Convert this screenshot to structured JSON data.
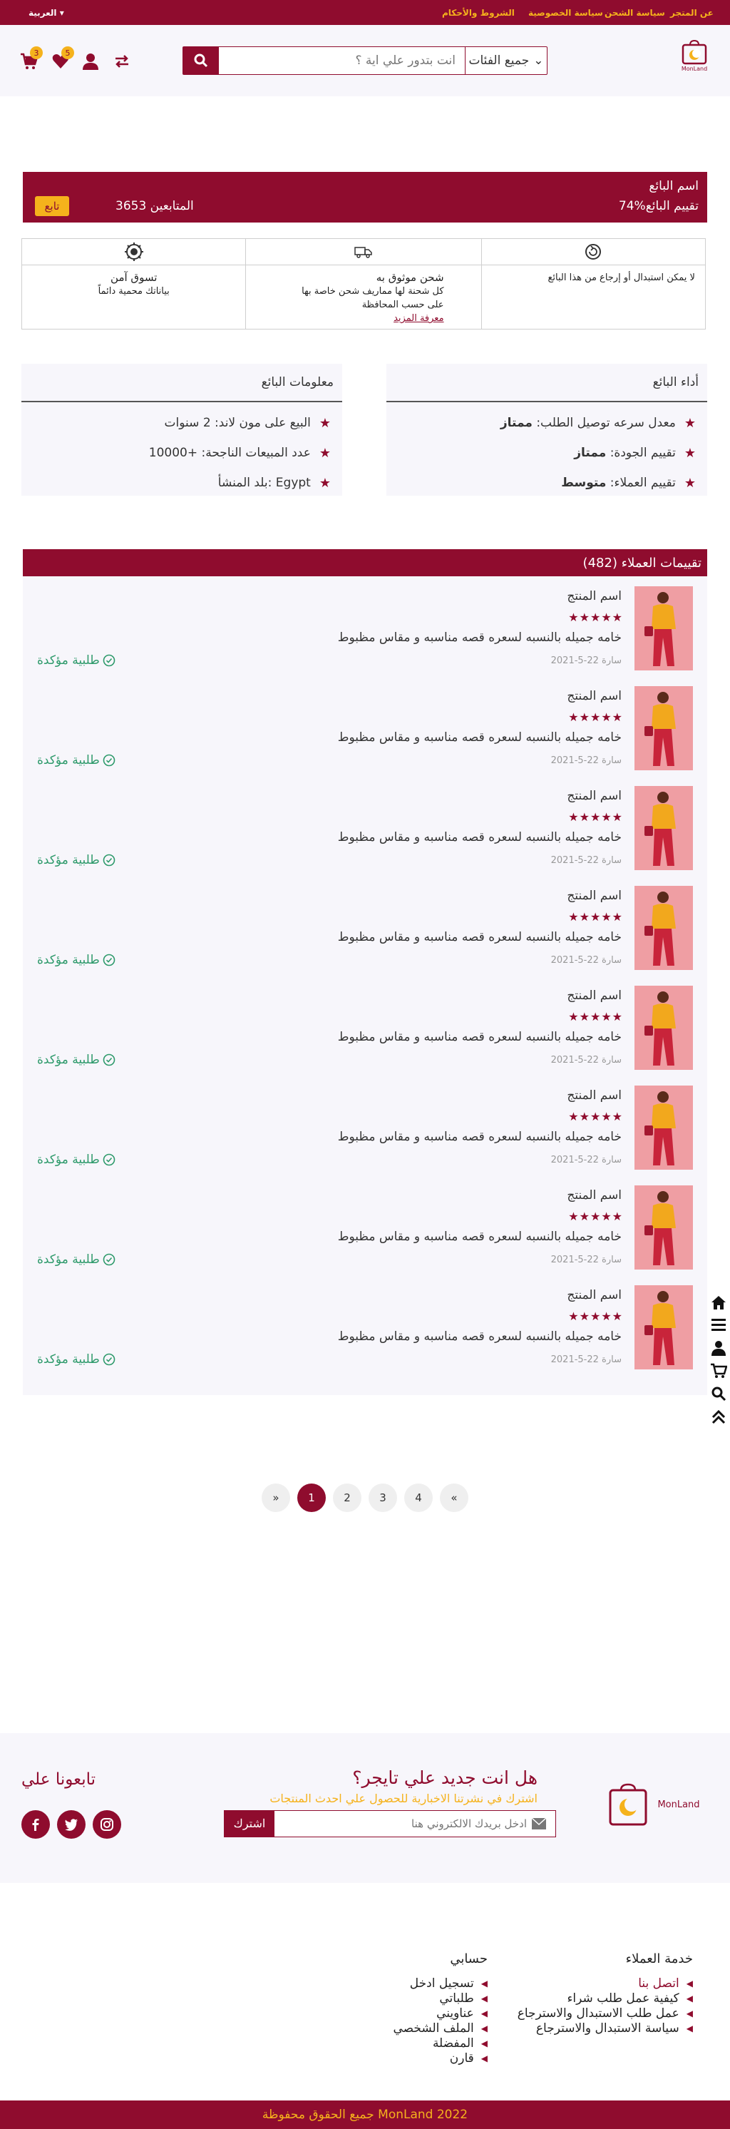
{
  "topbar": {
    "language": "العربية",
    "links": [
      "عن المتجر",
      "سياسة الشحن",
      "سياسة الخصوصية",
      "الشروط والأحكام"
    ]
  },
  "header": {
    "search_placeholder": "انت بتدور علي اية ؟",
    "category_label": "جميع الفئات",
    "cart_count": "3",
    "wishlist_count": "5",
    "logo_text": "MonLand"
  },
  "seller": {
    "name": "اسم البائع",
    "rating": "74%تقييم البائع",
    "followers": "3653 المتابعين",
    "follow_label": "تابع"
  },
  "features": [
    {
      "title": "",
      "text": "لا يمكن استبدال أو إرجاع من هذا البائع"
    },
    {
      "title": "شحن موثوق به",
      "text": "كل شحنة لها مماريف شحن خاصة بها على حسب المحافظة",
      "more": "معرفة المزيد"
    },
    {
      "title": "تسوق آمن",
      "text": "بياناتك محمية دائماً"
    }
  ],
  "performance": {
    "title": "أداء البائع",
    "rows": [
      {
        "label": "معدل سرعه توصيل الطلب:",
        "value": "ممتاز"
      },
      {
        "label": "تقييم الجودة:",
        "value": "ممتاز"
      },
      {
        "label": "تقييم العملاء:",
        "value": "متوسط"
      }
    ]
  },
  "info": {
    "title": "معلومات البائع",
    "rows": [
      {
        "label": "البيع على مون لاند: 2 سنوات"
      },
      {
        "label": "عدد المبيعات الناجحة: +10000"
      },
      {
        "label": "بلد المنشأ: Egypt"
      }
    ]
  },
  "reviews": {
    "title": "تقييمات العملاء (482)",
    "items": [
      {
        "product": "اسم المنتج",
        "stars": "★★★★★",
        "text": "خامه جميله بالنسبه لسعره قصه مناسبه و مقاس مظبوط",
        "date": "2021-5-22 سارة",
        "verified": "طلبية مؤكدة"
      },
      {
        "product": "اسم المنتج",
        "stars": "★★★★★",
        "text": "خامه جميله بالنسبه لسعره قصه مناسبه و مقاس مظبوط",
        "date": "2021-5-22 سارة",
        "verified": "طلبية مؤكدة"
      },
      {
        "product": "اسم المنتج",
        "stars": "★★★★★",
        "text": "خامه جميله بالنسبه لسعره قصه مناسبه و مقاس مظبوط",
        "date": "2021-5-22 سارة",
        "verified": "طلبية مؤكدة"
      },
      {
        "product": "اسم المنتج",
        "stars": "★★★★★",
        "text": "خامه جميله بالنسبه لسعره قصه مناسبه و مقاس مظبوط",
        "date": "2021-5-22 سارة",
        "verified": "طلبية مؤكدة"
      },
      {
        "product": "اسم المنتج",
        "stars": "★★★★★",
        "text": "خامه جميله بالنسبه لسعره قصه مناسبه و مقاس مظبوط",
        "date": "2021-5-22 سارة",
        "verified": "طلبية مؤكدة"
      },
      {
        "product": "اسم المنتج",
        "stars": "★★★★★",
        "text": "خامه جميله بالنسبه لسعره قصه مناسبه و مقاس مظبوط",
        "date": "2021-5-22 سارة",
        "verified": "طلبية مؤكدة"
      },
      {
        "product": "اسم المنتج",
        "stars": "★★★★★",
        "text": "خامه جميله بالنسبه لسعره قصه مناسبه و مقاس مظبوط",
        "date": "2021-5-22 سارة",
        "verified": "طلبية مؤكدة"
      },
      {
        "product": "اسم المنتج",
        "stars": "★★★★★",
        "text": "خامه جميله بالنسبه لسعره قصه مناسبه و مقاس مظبوط",
        "date": "2021-5-22 سارة",
        "verified": "طلبية مؤكدة"
      }
    ]
  },
  "pagination": {
    "pages": [
      "»",
      "1",
      "2",
      "3",
      "4",
      "«"
    ],
    "active": "1"
  },
  "newsletter": {
    "title": "هل انت جديد علي تايجر؟",
    "subtitle": "اشترك في نشرتنا الاخبارية للحصول علي احدث المنتجات",
    "placeholder": "ادخل بريدك الالكتروني هنا",
    "button": "اشترك",
    "follow_title": "تابعونا علي"
  },
  "footer": {
    "customer_service": {
      "title": "خدمة العملاء",
      "items": [
        "اتصل بنا",
        "كيفية عمل طلب شراء",
        "عمل طلب الاستبدال والاسترجاع",
        "سياسة الاستبدال والاسترجاع"
      ]
    },
    "account": {
      "title": "حسابي",
      "items": [
        "تسجيل ادخل",
        "طلباتي",
        "عناويني",
        "الملف الشخصي",
        "المفضلة",
        "قارن"
      ]
    },
    "copyright": "جميع الحقوق محفوظة  MonLand 2022"
  },
  "colors": {
    "brand": "#8f0c2e",
    "accent": "#f5b21c",
    "verified": "#2e9a6b"
  }
}
